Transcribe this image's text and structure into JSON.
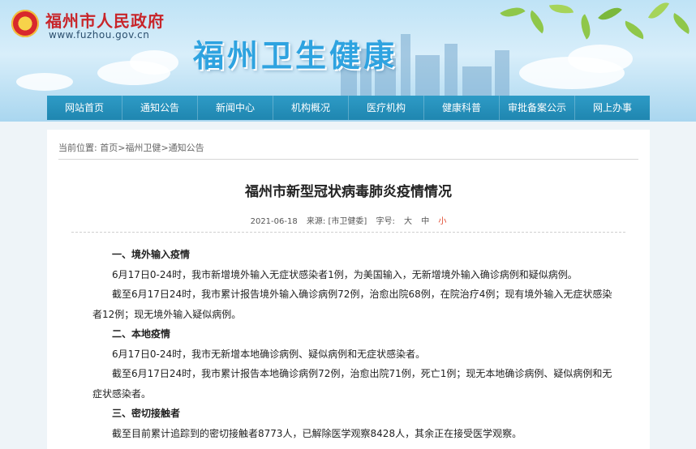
{
  "header": {
    "gov_title": "福州市人民政府",
    "gov_url": "www.fuzhou.gov.cn",
    "site_title": "福州卫生健康"
  },
  "nav": [
    {
      "label": "网站首页"
    },
    {
      "label": "通知公告"
    },
    {
      "label": "新闻中心"
    },
    {
      "label": "机构概况"
    },
    {
      "label": "医疗机构"
    },
    {
      "label": "健康科普"
    },
    {
      "label": "审批备案公示"
    },
    {
      "label": "网上办事"
    }
  ],
  "breadcrumb": {
    "prefix": "当前位置:",
    "home": "首页",
    "sep1": ">",
    "section": "福州卫健",
    "sep2": ">",
    "current": "通知公告"
  },
  "article": {
    "title": "福州市新型冠状病毒肺炎疫情情况",
    "date": "2021-06-18",
    "source": "来源: [市卫健委]",
    "fontsize_label": "字号:",
    "size_large": "大",
    "size_medium": "中",
    "size_small": "小",
    "paragraphs": [
      {
        "type": "heading",
        "text": "一、境外输入疫情"
      },
      {
        "type": "text",
        "text": "6月17日0-24时，我市新增境外输入无症状感染者1例，为美国输入，无新增境外输入确诊病例和疑似病例。"
      },
      {
        "type": "text",
        "text": "截至6月17日24时，我市累计报告境外输入确诊病例72例，治愈出院68例，在院治疗4例；现有境外输入无症状感染者12例；现无境外输入疑似病例。"
      },
      {
        "type": "heading",
        "text": "二、本地疫情"
      },
      {
        "type": "text",
        "text": "6月17日0-24时，我市无新增本地确诊病例、疑似病例和无症状感染者。"
      },
      {
        "type": "text",
        "text": "截至6月17日24时，我市累计报告本地确诊病例72例，治愈出院71例，死亡1例；现无本地确诊病例、疑似病例和无症状感染者。"
      },
      {
        "type": "heading",
        "text": "三、密切接触者"
      },
      {
        "type": "text",
        "text": "截至目前累计追踪到的密切接触者8773人，已解除医学观察8428人，其余正在接受医学观察。"
      }
    ]
  }
}
